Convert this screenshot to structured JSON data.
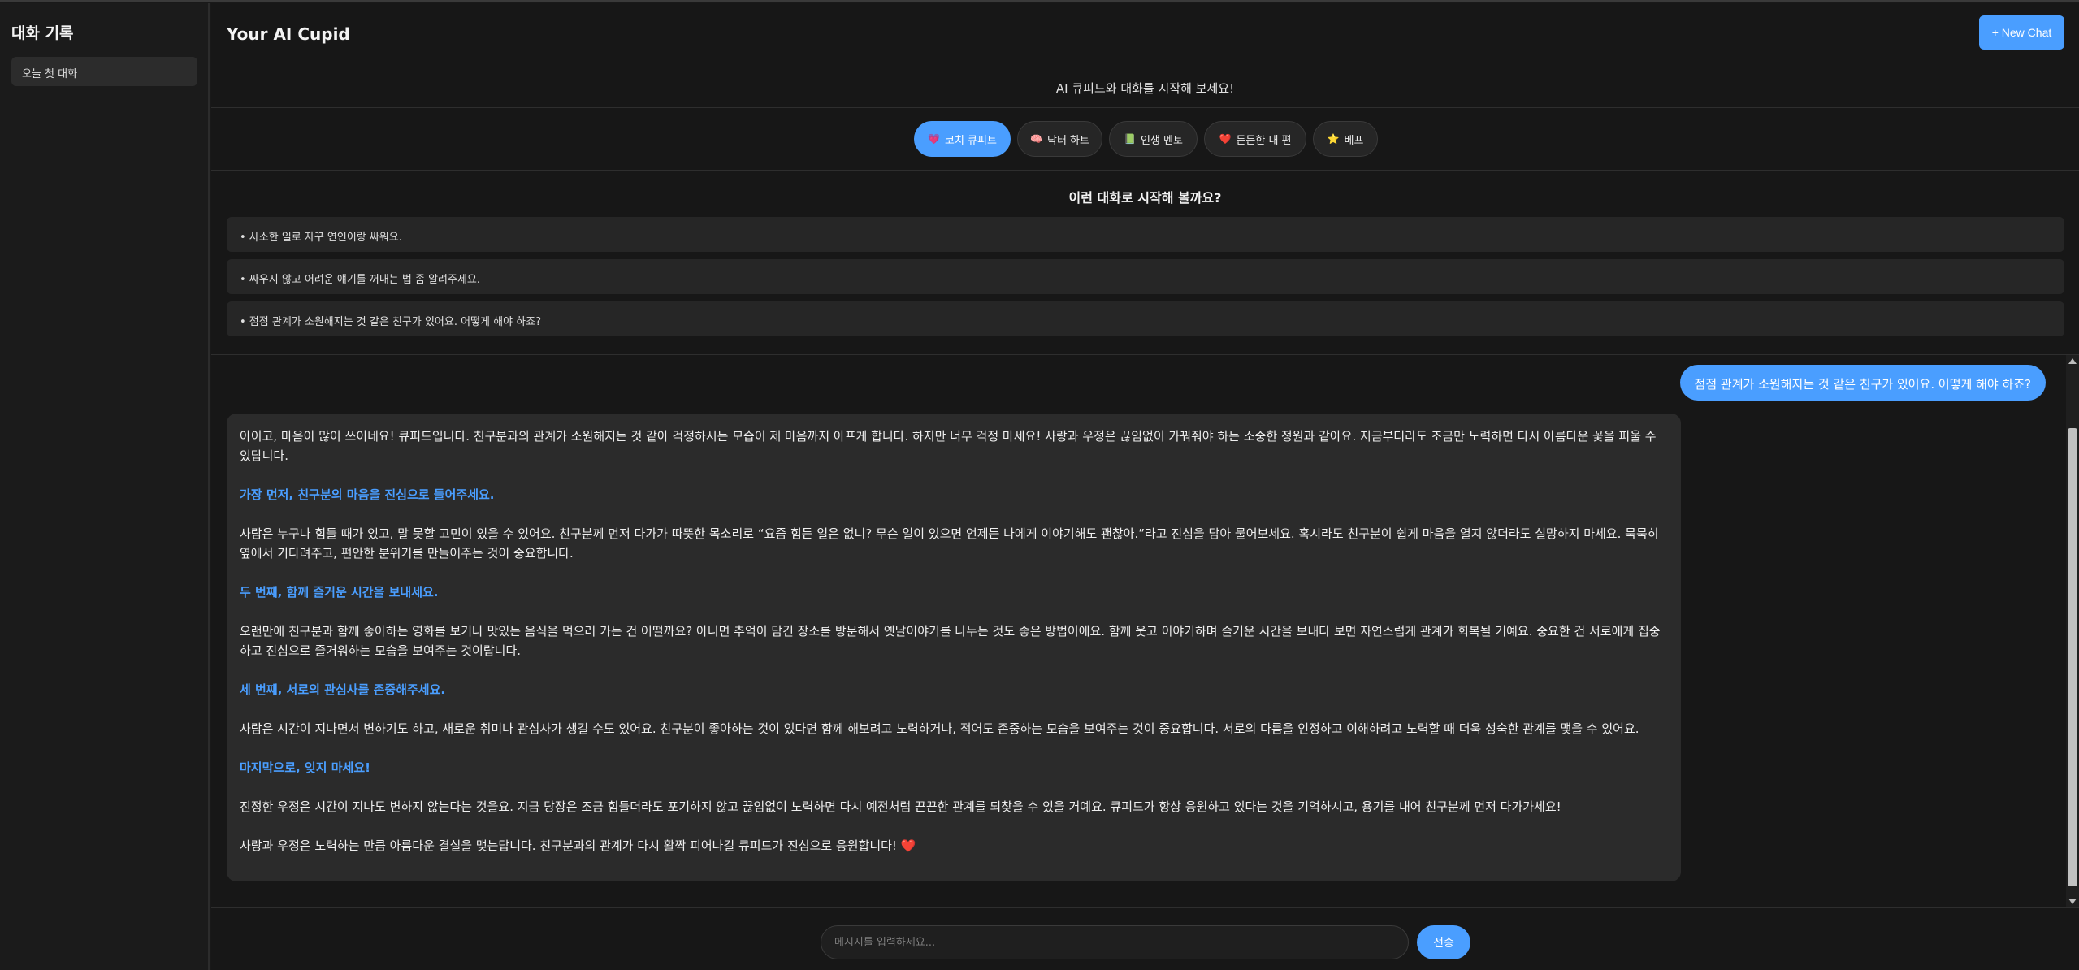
{
  "sidebar": {
    "title": "대화 기록",
    "items": [
      {
        "label": "오늘 첫 대화"
      }
    ]
  },
  "header": {
    "title": "Your AI Cupid",
    "new_chat_label": "+ New Chat"
  },
  "intro_text": "AI 큐피드와 대화를 시작해 보세요!",
  "personas": [
    {
      "icon": "💗",
      "label": "코치 큐피트",
      "active": true
    },
    {
      "icon": "🧠",
      "label": "닥터 하트",
      "active": false
    },
    {
      "icon": "📗",
      "label": "인생 멘토",
      "active": false
    },
    {
      "icon": "❤️",
      "label": "든든한 내 편",
      "active": false
    },
    {
      "icon": "⭐",
      "label": "베프",
      "active": false
    }
  ],
  "suggestions": {
    "title": "이런 대화로 시작해 볼까요?",
    "items": [
      "• 사소한 일로 자꾸 연인이랑 싸워요.",
      "• 싸우지 않고 어려운 얘기를 꺼내는 법 좀 알려주세요.",
      "• 점점 관계가 소원해지는 것 같은 친구가 있어요. 어떻게 해야 하죠?"
    ]
  },
  "conversation": {
    "user_message": "점점 관계가 소원해지는 것 같은 친구가 있어요. 어떻게 해야 하죠?",
    "assistant": {
      "p1": "아이고, 마음이 많이 쓰이네요! 큐피드입니다. 친구분과의 관계가 소원해지는 것 같아 걱정하시는 모습이 제 마음까지 아프게 합니다. 하지만 너무 걱정 마세요! 사랑과 우정은 끊임없이 가꿔줘야 하는 소중한 정원과 같아요. 지금부터라도 조금만 노력하면 다시 아름다운 꽃을 피울 수 있답니다.",
      "h1": "가장 먼저, 친구분의 마음을 진심으로 들어주세요.",
      "p2": "사람은 누구나 힘들 때가 있고, 말 못할 고민이 있을 수 있어요. 친구분께 먼저 다가가 따뜻한 목소리로 “요즘 힘든 일은 없니? 무슨 일이 있으면 언제든 나에게 이야기해도 괜찮아.”라고 진심을 담아 물어보세요. 혹시라도 친구분이 쉽게 마음을 열지 않더라도 실망하지 마세요. 묵묵히 옆에서 기다려주고, 편안한 분위기를 만들어주는 것이 중요합니다.",
      "h2": "두 번째, 함께 즐거운 시간을 보내세요.",
      "p3": "오랜만에 친구분과 함께 좋아하는 영화를 보거나 맛있는 음식을 먹으러 가는 건 어떨까요? 아니면 추억이 담긴 장소를 방문해서 옛날이야기를 나누는 것도 좋은 방법이에요. 함께 웃고 이야기하며 즐거운 시간을 보내다 보면 자연스럽게 관계가 회복될 거예요. 중요한 건 서로에게 집중하고 진심으로 즐거워하는 모습을 보여주는 것이랍니다.",
      "h3": "세 번째, 서로의 관심사를 존중해주세요.",
      "p4": "사람은 시간이 지나면서 변하기도 하고, 새로운 취미나 관심사가 생길 수도 있어요. 친구분이 좋아하는 것이 있다면 함께 해보려고 노력하거나, 적어도 존중하는 모습을 보여주는 것이 중요합니다. 서로의 다름을 인정하고 이해하려고 노력할 때 더욱 성숙한 관계를 맺을 수 있어요.",
      "h4": "마지막으로, 잊지 마세요!",
      "p5": "진정한 우정은 시간이 지나도 변하지 않는다는 것을요. 지금 당장은 조금 힘들더라도 포기하지 않고 끊임없이 노력하면 다시 예전처럼 끈끈한 관계를 되찾을 수 있을 거예요. 큐피드가 항상 응원하고 있다는 것을 기억하시고, 용기를 내어 친구분께 먼저 다가가세요!",
      "p6": "사랑과 우정은 노력하는 만큼 아름다운 결실을 맺는답니다. 친구분과의 관계가 다시 활짝 피어나길 큐피드가 진심으로 응원합니다!",
      "p6_icon": "❤️"
    }
  },
  "input": {
    "placeholder": "메시지를 입력하세요...",
    "value": "",
    "send_label": "전송"
  },
  "colors": {
    "accent": "#4a9eff",
    "background": "#171717",
    "surface": "#2b2b2b"
  }
}
